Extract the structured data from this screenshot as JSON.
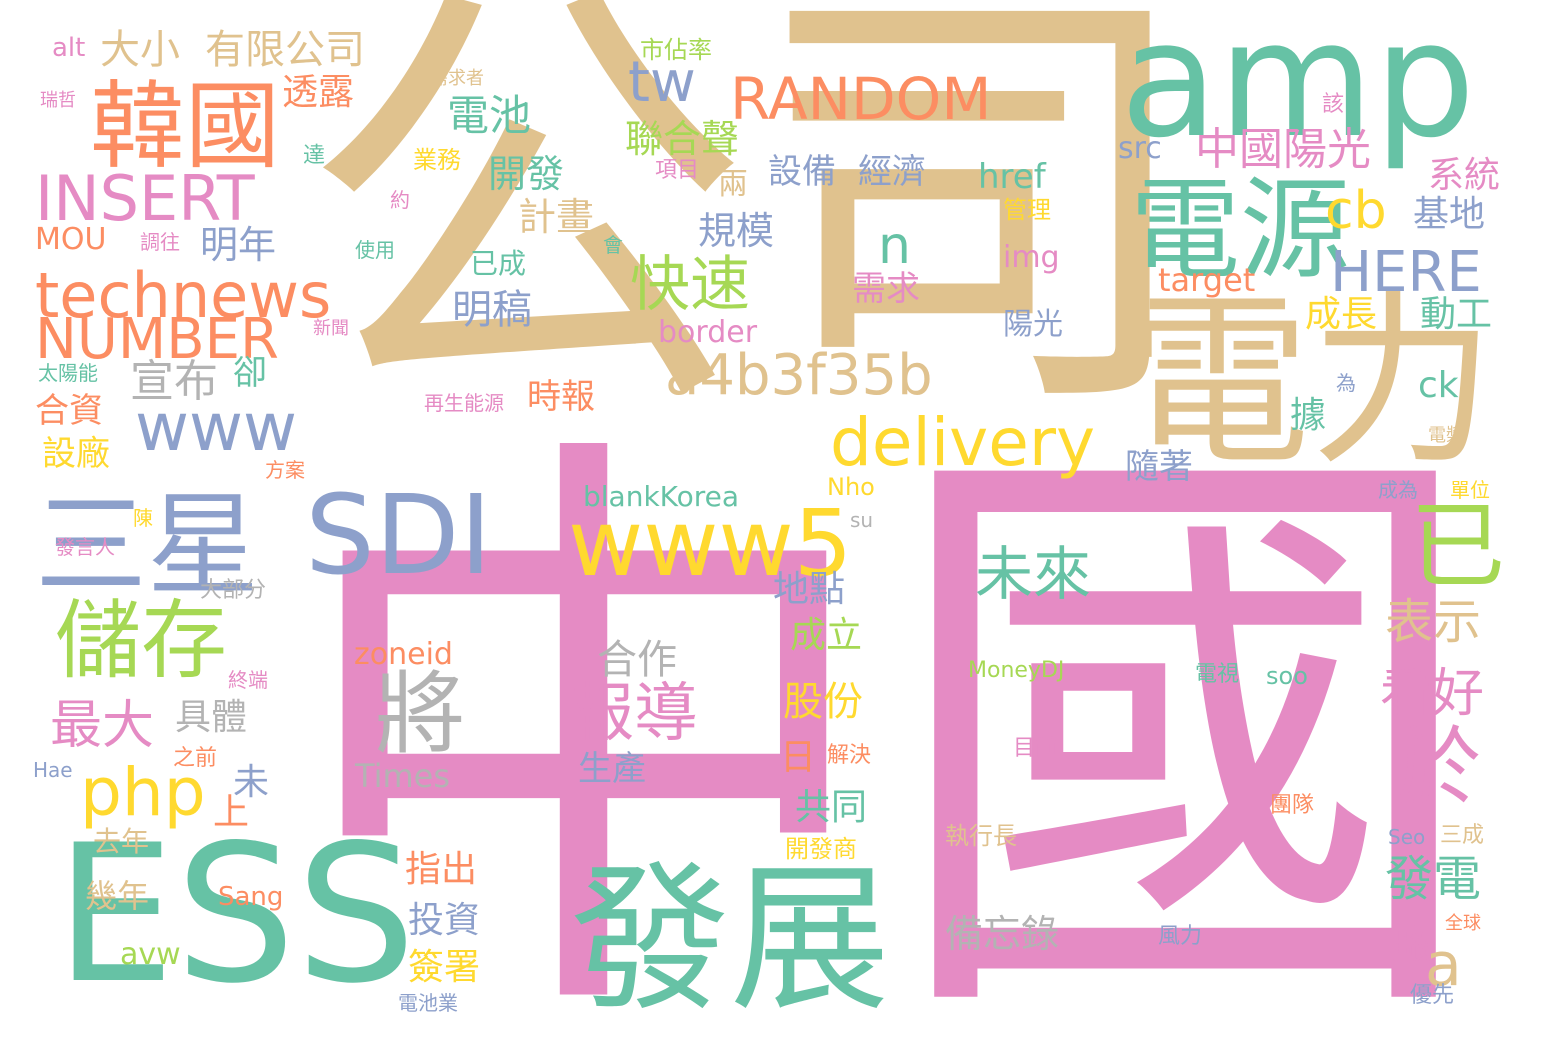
{
  "palette": {
    "tan": "#e0c28e",
    "pink": "#e58bc4",
    "green": "#66c2a5",
    "blue": "#8da0cb",
    "orange": "#fc8d62",
    "lime": "#a6d854",
    "yellow": "#ffd92f",
    "gray": "#b3b3b3"
  },
  "words": [
    {
      "text": "公司",
      "color": "tan"
    },
    {
      "text": "中國",
      "color": "pink"
    },
    {
      "text": "amp",
      "color": "green"
    },
    {
      "text": "電力",
      "color": "tan"
    },
    {
      "text": "ESS",
      "color": "green"
    },
    {
      "text": "發展",
      "color": "green"
    },
    {
      "text": "電源",
      "color": "green"
    },
    {
      "text": "韓國",
      "color": "orange"
    },
    {
      "text": "三星",
      "color": "blue"
    },
    {
      "text": "SDI",
      "color": "blue"
    },
    {
      "text": "technews",
      "color": "orange"
    },
    {
      "text": "INSERT",
      "color": "pink"
    },
    {
      "text": "NUMBER",
      "color": "orange"
    },
    {
      "text": "www5",
      "color": "yellow"
    },
    {
      "text": "儲存",
      "color": "lime"
    },
    {
      "text": "將",
      "color": "gray"
    },
    {
      "text": "www",
      "color": "blue"
    },
    {
      "text": "RANDOM",
      "color": "orange"
    },
    {
      "text": "a4b3f35b",
      "color": "tan"
    },
    {
      "text": "delivery",
      "color": "yellow"
    },
    {
      "text": "已",
      "color": "lime"
    },
    {
      "text": "於",
      "color": "pink"
    },
    {
      "text": "php",
      "color": "yellow"
    },
    {
      "text": "報導",
      "color": "pink"
    },
    {
      "text": "HERE",
      "color": "blue"
    },
    {
      "text": "快速",
      "color": "lime"
    },
    {
      "text": "未來",
      "color": "green"
    },
    {
      "text": "tw",
      "color": "blue"
    },
    {
      "text": "cb",
      "color": "yellow"
    },
    {
      "text": "n",
      "color": "green"
    },
    {
      "text": "a",
      "color": "tan"
    },
    {
      "text": "最大",
      "color": "pink"
    },
    {
      "text": "表示",
      "color": "tan"
    },
    {
      "text": "看好",
      "color": "pink"
    },
    {
      "text": "發電",
      "color": "green"
    },
    {
      "text": "宣布",
      "color": "gray"
    },
    {
      "text": "中國陽光",
      "color": "pink"
    },
    {
      "text": "有限公司",
      "color": "tan"
    },
    {
      "text": "大小",
      "color": "tan"
    },
    {
      "text": "電池",
      "color": "green"
    },
    {
      "text": "透露",
      "color": "orange"
    },
    {
      "text": "開發",
      "color": "green"
    },
    {
      "text": "聯合聲",
      "color": "lime"
    },
    {
      "text": "計畫",
      "color": "tan"
    },
    {
      "text": "規模",
      "color": "blue"
    },
    {
      "text": "明年",
      "color": "blue"
    },
    {
      "text": "明稿",
      "color": "blue"
    },
    {
      "text": "設備",
      "color": "blue"
    },
    {
      "text": "經濟",
      "color": "blue"
    },
    {
      "text": "系統",
      "color": "pink"
    },
    {
      "text": "基地",
      "color": "blue"
    },
    {
      "text": "動工",
      "color": "green"
    },
    {
      "text": "成長",
      "color": "yellow"
    },
    {
      "text": "時報",
      "color": "orange"
    },
    {
      "text": "合資",
      "color": "orange"
    },
    {
      "text": "設廠",
      "color": "yellow"
    },
    {
      "text": "卻",
      "color": "green"
    },
    {
      "text": "隨著",
      "color": "blue"
    },
    {
      "text": "據",
      "color": "green"
    },
    {
      "text": "ck",
      "color": "green"
    },
    {
      "text": "地點",
      "color": "blue"
    },
    {
      "text": "成立",
      "color": "lime"
    },
    {
      "text": "股份",
      "color": "yellow"
    },
    {
      "text": "合作",
      "color": "gray"
    },
    {
      "text": "zoneid",
      "color": "orange"
    },
    {
      "text": "具體",
      "color": "gray"
    },
    {
      "text": "生產",
      "color": "blue"
    },
    {
      "text": "日",
      "color": "orange"
    },
    {
      "text": "共同",
      "color": "green"
    },
    {
      "text": "指出",
      "color": "orange"
    },
    {
      "text": "投資",
      "color": "blue"
    },
    {
      "text": "簽署",
      "color": "yellow"
    },
    {
      "text": "廠",
      "color": "pink"
    },
    {
      "text": "備忘錄",
      "color": "gray"
    },
    {
      "text": "上",
      "color": "orange"
    },
    {
      "text": "未",
      "color": "blue"
    },
    {
      "text": "Times",
      "color": "gray"
    },
    {
      "text": "幾年",
      "color": "tan"
    },
    {
      "text": "avw",
      "color": "lime"
    },
    {
      "text": "去年",
      "color": "tan"
    },
    {
      "text": "href",
      "color": "green"
    },
    {
      "text": "img",
      "color": "pink"
    },
    {
      "text": "target",
      "color": "orange"
    },
    {
      "text": "src",
      "color": "blue"
    },
    {
      "text": "border",
      "color": "pink"
    },
    {
      "text": "MOU",
      "color": "orange"
    },
    {
      "text": "blankKorea",
      "color": "green"
    },
    {
      "text": "需求",
      "color": "pink"
    },
    {
      "text": "已成",
      "color": "green"
    },
    {
      "text": "陽光",
      "color": "blue"
    },
    {
      "text": "兩",
      "color": "tan"
    },
    {
      "text": "業務",
      "color": "yellow"
    },
    {
      "text": "項目",
      "color": "pink"
    },
    {
      "text": "管理",
      "color": "yellow"
    },
    {
      "text": "市佔率",
      "color": "lime"
    },
    {
      "text": "alt",
      "color": "pink"
    },
    {
      "text": "需求者",
      "color": "tan"
    },
    {
      "text": "瑞哲",
      "color": "pink"
    },
    {
      "text": "達",
      "color": "green"
    },
    {
      "text": "約",
      "color": "pink"
    },
    {
      "text": "調往",
      "color": "pink"
    },
    {
      "text": "使用",
      "color": "green"
    },
    {
      "text": "會",
      "color": "green"
    },
    {
      "text": "新聞",
      "color": "pink"
    },
    {
      "text": "太陽能",
      "color": "green"
    },
    {
      "text": "再生能源",
      "color": "pink"
    },
    {
      "text": "方案",
      "color": "orange"
    },
    {
      "text": "陳",
      "color": "yellow"
    },
    {
      "text": "發言人",
      "color": "pink"
    },
    {
      "text": "大部分",
      "color": "gray"
    },
    {
      "text": "終端",
      "color": "pink"
    },
    {
      "text": "之前",
      "color": "orange"
    },
    {
      "text": "Hae",
      "color": "blue"
    },
    {
      "text": "Sang",
      "color": "orange"
    },
    {
      "text": "Nho",
      "color": "yellow"
    },
    {
      "text": "su",
      "color": "gray"
    },
    {
      "text": "MoneyDJ",
      "color": "lime"
    },
    {
      "text": "目前",
      "color": "pink"
    },
    {
      "text": "解決",
      "color": "orange"
    },
    {
      "text": "執行長",
      "color": "tan"
    },
    {
      "text": "開發商",
      "color": "yellow"
    },
    {
      "text": "電視",
      "color": "green"
    },
    {
      "text": "soo",
      "color": "green"
    },
    {
      "text": "團隊",
      "color": "orange"
    },
    {
      "text": "Seo",
      "color": "blue"
    },
    {
      "text": "三成",
      "color": "tan"
    },
    {
      "text": "風力",
      "color": "blue"
    },
    {
      "text": "全球",
      "color": "orange"
    },
    {
      "text": "電池業",
      "color": "blue"
    },
    {
      "text": "優先",
      "color": "blue"
    },
    {
      "text": "成為",
      "color": "blue"
    },
    {
      "text": "單位",
      "color": "yellow"
    },
    {
      "text": "電漿",
      "color": "tan"
    },
    {
      "text": "為",
      "color": "blue"
    },
    {
      "text": "該",
      "color": "pink"
    }
  ]
}
